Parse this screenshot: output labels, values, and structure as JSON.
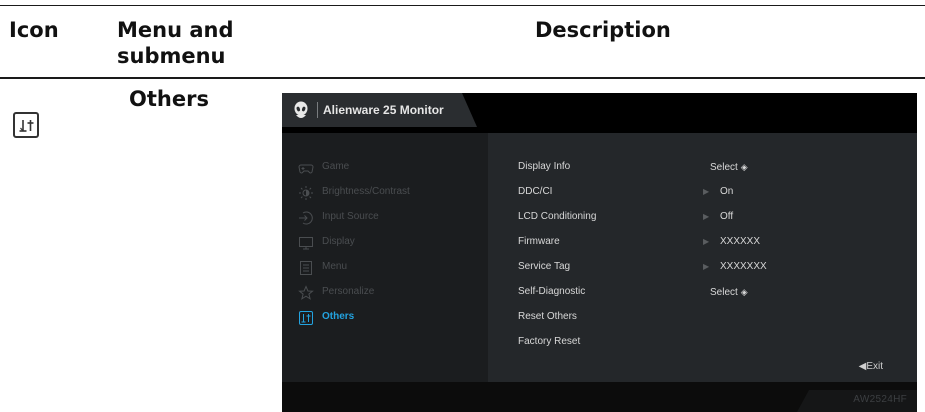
{
  "table": {
    "headers": {
      "icon": "Icon",
      "menu": "Menu and submenu",
      "description": "Description"
    },
    "row": {
      "menu_title": "Others",
      "icon": "others-icon"
    }
  },
  "osd": {
    "title": "Alienware 25 Monitor",
    "model": "AW2524HF",
    "exit_label": "Exit",
    "left_menu": [
      {
        "label": "Game",
        "icon": "gamepad-icon"
      },
      {
        "label": "Brightness/Contrast",
        "icon": "brightness-icon"
      },
      {
        "label": "Input Source",
        "icon": "input-source-icon"
      },
      {
        "label": "Display",
        "icon": "display-icon"
      },
      {
        "label": "Menu",
        "icon": "menu-icon"
      },
      {
        "label": "Personalize",
        "icon": "star-icon"
      },
      {
        "label": "Others",
        "icon": "others-icon",
        "active": true
      }
    ],
    "options": [
      {
        "label": "Display Info",
        "arrow": "",
        "value": "Select",
        "select_icon": true
      },
      {
        "label": "DDC/CI",
        "arrow": "▶",
        "value": "On"
      },
      {
        "label": "LCD Conditioning",
        "arrow": "▶",
        "value": "Off"
      },
      {
        "label": "Firmware",
        "arrow": "▶",
        "value": "XXXXXX"
      },
      {
        "label": "Service Tag",
        "arrow": "▶",
        "value": "XXXXXXX"
      },
      {
        "label": "Self-Diagnostic",
        "arrow": "",
        "value": "Select",
        "select_icon": true
      },
      {
        "label": "Reset Others",
        "arrow": "",
        "value": ""
      },
      {
        "label": "Factory Reset",
        "arrow": "",
        "value": ""
      }
    ],
    "colors": {
      "accent": "#23a3e0",
      "panel_left": "#1b1d1f",
      "panel_right": "#24272a"
    }
  }
}
